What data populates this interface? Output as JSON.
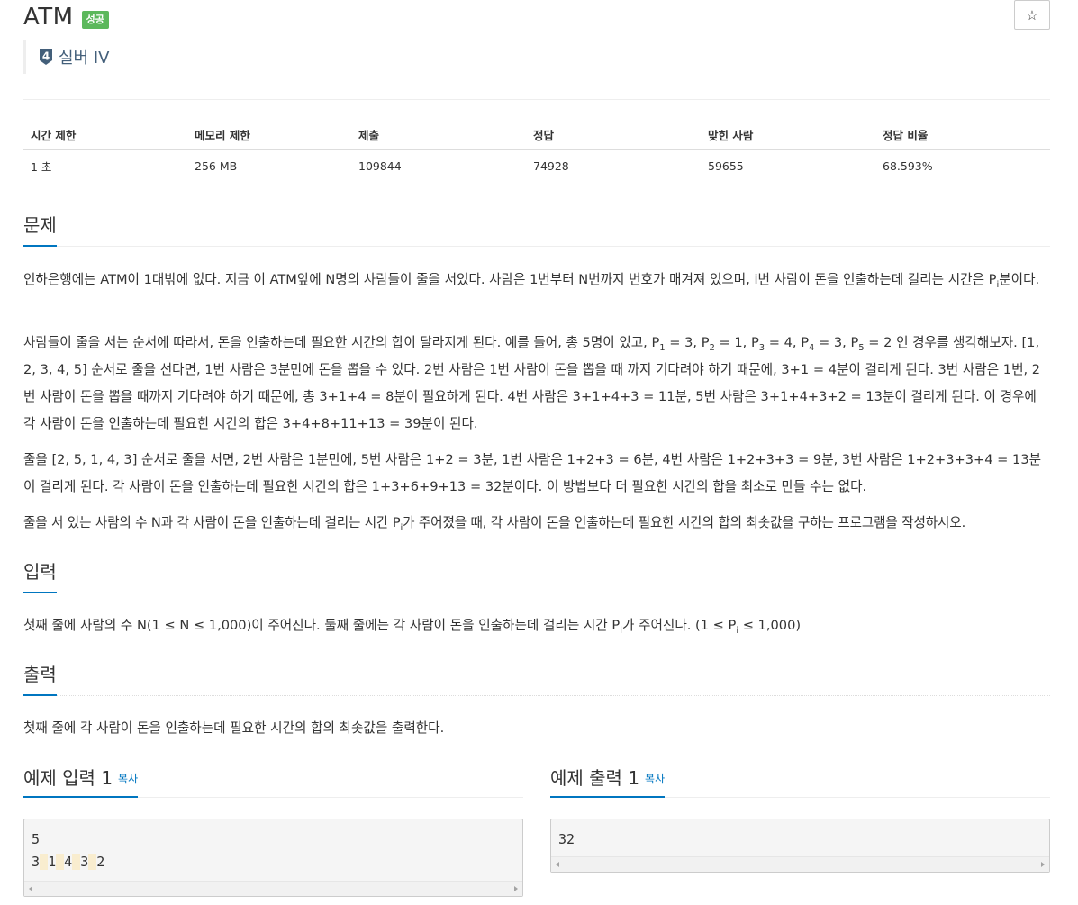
{
  "problem": {
    "title": "ATM",
    "status_badge": "성공",
    "tier_number": "4",
    "tier_label": "실버 IV"
  },
  "colors": {
    "accent": "#0076c0",
    "success": "#5cb85c",
    "tier": "#435f7a",
    "highlight": "#f9edcf"
  },
  "icons": {
    "star": "star-icon",
    "tier": "silver-tier-shield-icon"
  },
  "star_glyph": "☆",
  "info_table": {
    "headers": [
      "시간 제한",
      "메모리 제한",
      "제출",
      "정답",
      "맞힌 사람",
      "정답 비율"
    ],
    "values": [
      "1 초",
      "256 MB",
      "109844",
      "74928",
      "59655",
      "68.593%"
    ]
  },
  "sections": {
    "description_title": "문제",
    "input_title": "입력",
    "output_title": "출력"
  },
  "description": {
    "p1": "인하은행에는 ATM이 1대밖에 없다. 지금 이 ATM앞에 N명의 사람들이 줄을 서있다. 사람은 1번부터 N번까지 번호가 매겨져 있으며, i번 사람이 돈을 인출하는데 걸리는 시간은 P",
    "p1_sub": "i",
    "p1_end": "분이다.",
    "p2_a": "사람들이 줄을 서는 순서에 따라서, 돈을 인출하는데 필요한 시간의 합이 달라지게 된다. 예를 들어, 총 5명이 있고, P",
    "p2_s1": "1",
    "p2_b": " = 3, P",
    "p2_s2": "2",
    "p2_c": " = 1, P",
    "p2_s3": "3",
    "p2_d": " = 4, P",
    "p2_s4": "4",
    "p2_e": " = 3, P",
    "p2_s5": "5",
    "p2_f": " = 2 인 경우를 생각해보자. [1, 2, 3, 4, 5] 순서로 줄을 선다면, 1번 사람은 3분만에 돈을 뽑을 수 있다. 2번 사람은 1번 사람이 돈을 뽑을 때 까지 기다려야 하기 때문에, 3+1 = 4분이 걸리게 된다. 3번 사람은 1번, 2번 사람이 돈을 뽑을 때까지 기다려야 하기 때문에, 총 3+1+4 = 8분이 필요하게 된다. 4번 사람은 3+1+4+3 = 11분, 5번 사람은 3+1+4+3+2 = 13분이 걸리게 된다. 이 경우에 각 사람이 돈을 인출하는데 필요한 시간의 합은 3+4+8+11+13 = 39분이 된다.",
    "p3": "줄을 [2, 5, 1, 4, 3] 순서로 줄을 서면, 2번 사람은 1분만에, 5번 사람은 1+2 = 3분, 1번 사람은 1+2+3 = 6분, 4번 사람은 1+2+3+3 = 9분, 3번 사람은 1+2+3+3+4 = 13분이 걸리게 된다. 각 사람이 돈을 인출하는데 필요한 시간의 합은 1+3+6+9+13 = 32분이다. 이 방법보다 더 필요한 시간의 합을 최소로 만들 수는 없다.",
    "p4_a": "줄을 서 있는 사람의 수 N과 각 사람이 돈을 인출하는데 걸리는 시간 P",
    "p4_sub": "i",
    "p4_b": "가 주어졌을 때, 각 사람이 돈을 인출하는데 필요한 시간의 합의 최솟값을 구하는 프로그램을 작성하시오."
  },
  "input": {
    "a": "첫째 줄에 사람의 수 N(1 ≤ N ≤ 1,000)이 주어진다. 둘째 줄에는 각 사람이 돈을 인출하는데 걸리는 시간 P",
    "s1": "i",
    "b": "가 주어진다. (1 ≤ P",
    "s2": "i",
    "c": " ≤ 1,000)"
  },
  "output": {
    "text": "첫째 줄에 각 사람이 돈을 인출하는데 필요한 시간의 합의 최솟값을 출력한다."
  },
  "samples": {
    "input_title": "예제 입력 1",
    "output_title": "예제 출력 1",
    "copy_label": "복사",
    "input_line1": "5",
    "input_line2_tokens": [
      "3",
      " ",
      "1",
      " ",
      "4",
      " ",
      "3",
      " ",
      "2"
    ],
    "output_line1": "32"
  }
}
